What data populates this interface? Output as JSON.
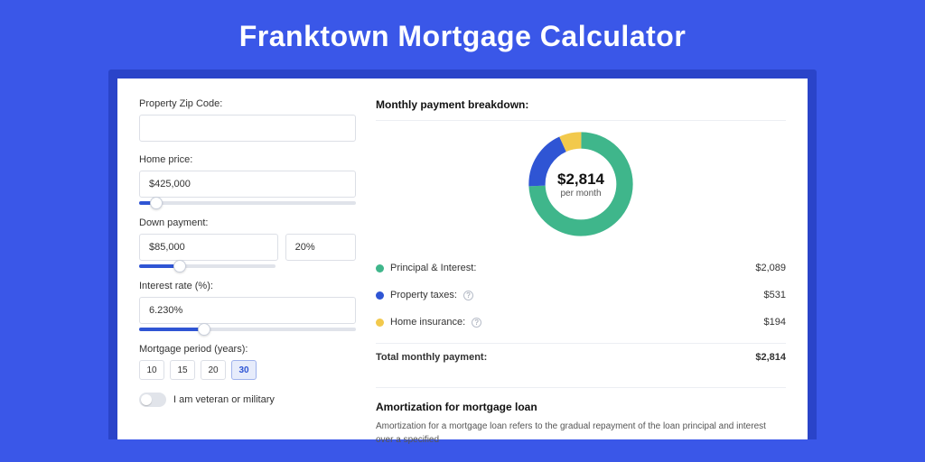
{
  "title": "Franktown Mortgage Calculator",
  "form": {
    "zip_label": "Property Zip Code:",
    "zip_value": "",
    "home_label": "Home price:",
    "home_value": "$425,000",
    "home_slider_pct": 8,
    "down_label": "Down payment:",
    "down_value": "$85,000",
    "down_pct_value": "20%",
    "down_slider_pct": 20,
    "rate_label": "Interest rate (%):",
    "rate_value": "6.230%",
    "rate_slider_pct": 30,
    "period_label": "Mortgage period (years):",
    "period_options": [
      "10",
      "15",
      "20",
      "30"
    ],
    "period_selected": "30",
    "veteran_label": "I am veteran or military"
  },
  "breakdown": {
    "header": "Monthly payment breakdown:",
    "center_amount": "$2,814",
    "center_sub": "per month",
    "items": [
      {
        "label": "Principal & Interest:",
        "color": "green",
        "amount": "$2,089",
        "info": false
      },
      {
        "label": "Property taxes:",
        "color": "blue",
        "amount": "$531",
        "info": true
      },
      {
        "label": "Home insurance:",
        "color": "yellow",
        "amount": "$194",
        "info": true
      }
    ],
    "total_label": "Total monthly payment:",
    "total_amount": "$2,814"
  },
  "chart_data": {
    "type": "pie",
    "title": "Monthly payment breakdown",
    "series": [
      {
        "name": "Principal & Interest",
        "value": 2089,
        "color": "#3fb68b"
      },
      {
        "name": "Property taxes",
        "value": 531,
        "color": "#2f55d4"
      },
      {
        "name": "Home insurance",
        "value": 194,
        "color": "#f2c94c"
      }
    ],
    "total": 2814
  },
  "amort": {
    "header": "Amortization for mortgage loan",
    "text": "Amortization for a mortgage loan refers to the gradual repayment of the loan principal and interest over a specified"
  }
}
